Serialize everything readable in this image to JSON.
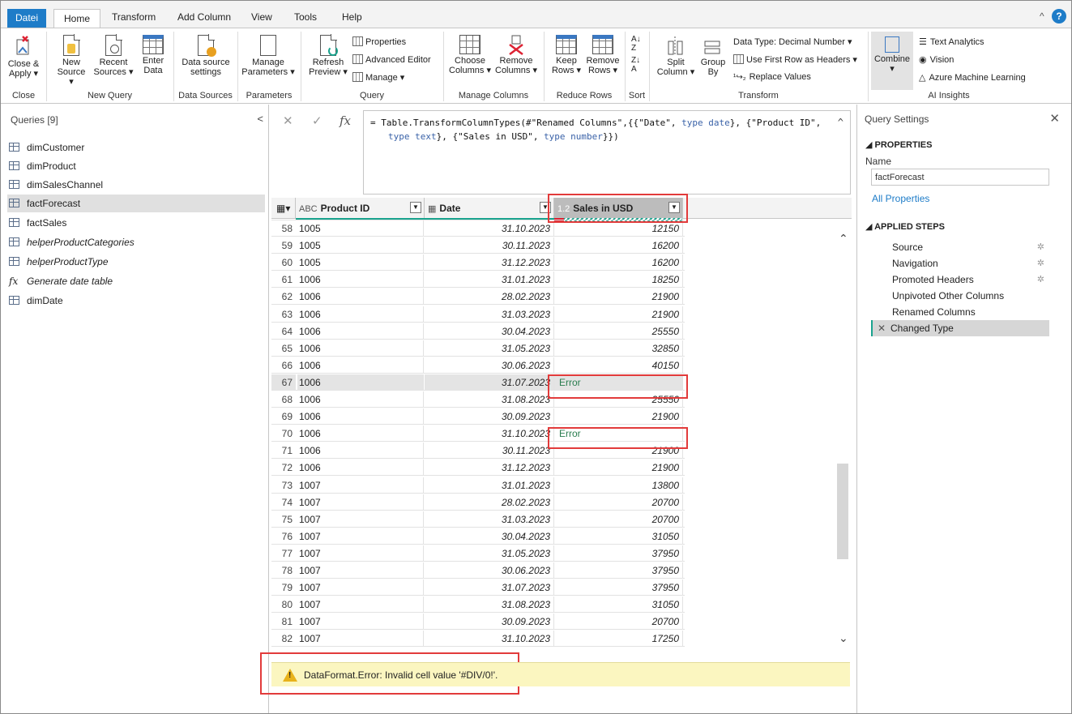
{
  "tabs": [
    "Datei",
    "Home",
    "Transform",
    "Add Column",
    "View",
    "Tools",
    "Help"
  ],
  "ribbon": {
    "close_apply": "Close &\nApply ▾",
    "new_source": "New\nSource ▾",
    "recent_sources": "Recent\nSources ▾",
    "enter_data": "Enter\nData",
    "data_source_settings": "Data source\nsettings",
    "manage_parameters": "Manage\nParameters ▾",
    "refresh_preview": "Refresh\nPreview ▾",
    "properties": "Properties",
    "advanced_editor": "Advanced Editor",
    "manage": "Manage ▾",
    "choose_columns": "Choose\nColumns ▾",
    "remove_columns": "Remove\nColumns ▾",
    "keep_rows": "Keep\nRows ▾",
    "remove_rows": "Remove\nRows ▾",
    "split_column": "Split\nColumn ▾",
    "group_by": "Group\nBy",
    "data_type": "Data Type: Decimal Number ▾",
    "first_row_headers": "Use First Row as Headers ▾",
    "replace_values": "Replace Values",
    "combine": "Combine\n▾",
    "text_analytics": "Text Analytics",
    "vision": "Vision",
    "azure_ml": "Azure Machine Learning",
    "groups": [
      "Close",
      "New Query",
      "Data Sources",
      "Parameters",
      "Query",
      "Manage Columns",
      "Reduce Rows",
      "Sort",
      "Transform",
      "AI Insights"
    ]
  },
  "queries": {
    "title": "Queries [9]",
    "items": [
      {
        "name": "dimCustomer",
        "type": "table",
        "italic": false
      },
      {
        "name": "dimProduct",
        "type": "table",
        "italic": false
      },
      {
        "name": "dimSalesChannel",
        "type": "table",
        "italic": false
      },
      {
        "name": "factForecast",
        "type": "table",
        "italic": false,
        "selected": true
      },
      {
        "name": "factSales",
        "type": "table",
        "italic": false
      },
      {
        "name": "helperProductCategories",
        "type": "table",
        "italic": true
      },
      {
        "name": "helperProductType",
        "type": "table",
        "italic": true
      },
      {
        "name": "Generate date table",
        "type": "function",
        "italic": true
      },
      {
        "name": "dimDate",
        "type": "table",
        "italic": false
      }
    ]
  },
  "formula": {
    "line1_prefix": "= Table.TransformColumnTypes(#\"Renamed Columns\",{{\"Date\", ",
    "line1_type1": "type date",
    "line1_mid": "}, {\"Product ID\",",
    "line2_type2": "type text",
    "line2_mid": "}, {\"Sales in USD\", ",
    "line2_type3": "type number",
    "line2_suffix": "}})"
  },
  "grid": {
    "columns": [
      {
        "name": "Product ID",
        "type_badge": "ABC"
      },
      {
        "name": "Date",
        "type_badge": "▦"
      },
      {
        "name": "Sales in USD",
        "type_badge": "1.2"
      }
    ],
    "rows": [
      {
        "n": "58",
        "id": "1005",
        "date": "31.10.2023",
        "sales": "12150"
      },
      {
        "n": "59",
        "id": "1005",
        "date": "30.11.2023",
        "sales": "16200"
      },
      {
        "n": "60",
        "id": "1005",
        "date": "31.12.2023",
        "sales": "16200"
      },
      {
        "n": "61",
        "id": "1006",
        "date": "31.01.2023",
        "sales": "18250"
      },
      {
        "n": "62",
        "id": "1006",
        "date": "28.02.2023",
        "sales": "21900"
      },
      {
        "n": "63",
        "id": "1006",
        "date": "31.03.2023",
        "sales": "21900"
      },
      {
        "n": "64",
        "id": "1006",
        "date": "30.04.2023",
        "sales": "25550"
      },
      {
        "n": "65",
        "id": "1006",
        "date": "31.05.2023",
        "sales": "32850"
      },
      {
        "n": "66",
        "id": "1006",
        "date": "30.06.2023",
        "sales": "40150"
      },
      {
        "n": "67",
        "id": "1006",
        "date": "31.07.2023",
        "sales": "Error",
        "error": true,
        "highlight": true
      },
      {
        "n": "68",
        "id": "1006",
        "date": "31.08.2023",
        "sales": "25550"
      },
      {
        "n": "69",
        "id": "1006",
        "date": "30.09.2023",
        "sales": "21900"
      },
      {
        "n": "70",
        "id": "1006",
        "date": "31.10.2023",
        "sales": "Error",
        "error": true
      },
      {
        "n": "71",
        "id": "1006",
        "date": "30.11.2023",
        "sales": "21900"
      },
      {
        "n": "72",
        "id": "1006",
        "date": "31.12.2023",
        "sales": "21900"
      },
      {
        "n": "73",
        "id": "1007",
        "date": "31.01.2023",
        "sales": "13800"
      },
      {
        "n": "74",
        "id": "1007",
        "date": "28.02.2023",
        "sales": "20700"
      },
      {
        "n": "75",
        "id": "1007",
        "date": "31.03.2023",
        "sales": "20700"
      },
      {
        "n": "76",
        "id": "1007",
        "date": "30.04.2023",
        "sales": "31050"
      },
      {
        "n": "77",
        "id": "1007",
        "date": "31.05.2023",
        "sales": "37950"
      },
      {
        "n": "78",
        "id": "1007",
        "date": "30.06.2023",
        "sales": "37950"
      },
      {
        "n": "79",
        "id": "1007",
        "date": "31.07.2023",
        "sales": "37950"
      },
      {
        "n": "80",
        "id": "1007",
        "date": "31.08.2023",
        "sales": "31050"
      },
      {
        "n": "81",
        "id": "1007",
        "date": "30.09.2023",
        "sales": "20700"
      },
      {
        "n": "82",
        "id": "1007",
        "date": "31.10.2023",
        "sales": "17250"
      }
    ]
  },
  "error_bar": {
    "message": "DataFormat.Error: Invalid cell value '#DIV/0!'."
  },
  "settings": {
    "title": "Query Settings",
    "properties_label": "PROPERTIES",
    "name_label": "Name",
    "name_value": "factForecast",
    "all_properties": "All Properties",
    "applied_steps_label": "APPLIED STEPS",
    "steps": [
      {
        "name": "Source",
        "gear": true
      },
      {
        "name": "Navigation",
        "gear": true
      },
      {
        "name": "Promoted Headers",
        "gear": true
      },
      {
        "name": "Unpivoted Other Columns",
        "gear": false
      },
      {
        "name": "Renamed Columns",
        "gear": false
      },
      {
        "name": "Changed Type",
        "gear": false,
        "selected": true
      }
    ]
  },
  "colors": {
    "accent": "#1e7cc8",
    "teal": "#1aa38e",
    "error_text": "#2a7d4f",
    "highlight_box": "#e23b3b",
    "error_bar_bg": "#fbf6c0"
  }
}
